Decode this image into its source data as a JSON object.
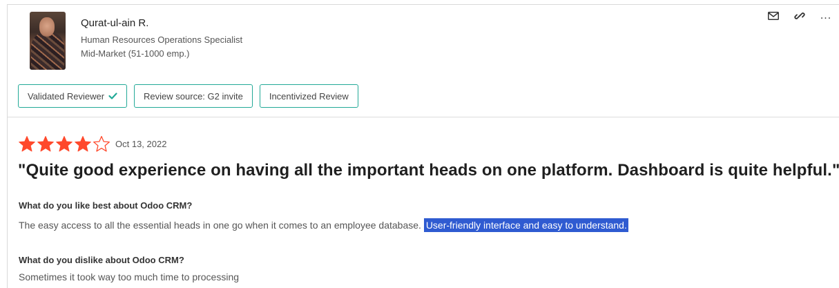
{
  "reviewer": {
    "name": "Qurat-ul-ain R.",
    "title": "Human Resources Operations Specialist",
    "segment": "Mid-Market (51-1000 emp.)"
  },
  "actions": {
    "email_icon": "envelope-icon",
    "link_icon": "link-icon",
    "more_label": "..."
  },
  "badges": [
    {
      "label": "Validated Reviewer",
      "icon": "check-icon"
    },
    {
      "label": "Review source: G2 invite"
    },
    {
      "label": "Incentivized Review"
    }
  ],
  "review": {
    "rating": 4,
    "rating_max": 5,
    "date": "Oct 13, 2022",
    "headline": "\"Quite good experience on having all the important heads on one platform. Dashboard is quite helpful.\"",
    "q1": "What do you like best about Odoo CRM?",
    "a1_plain": "The easy access to all the essential heads in one go when it comes to an employee database.",
    "a1_highlight": "User-friendly interface and easy to understand.",
    "q2": "What do you dislike about Odoo CRM?",
    "a2": "Sometimes it took way too much time to processing"
  },
  "colors": {
    "star": "#ff492c",
    "badge_border": "#21a997",
    "highlight_bg": "#2f5bd1"
  }
}
